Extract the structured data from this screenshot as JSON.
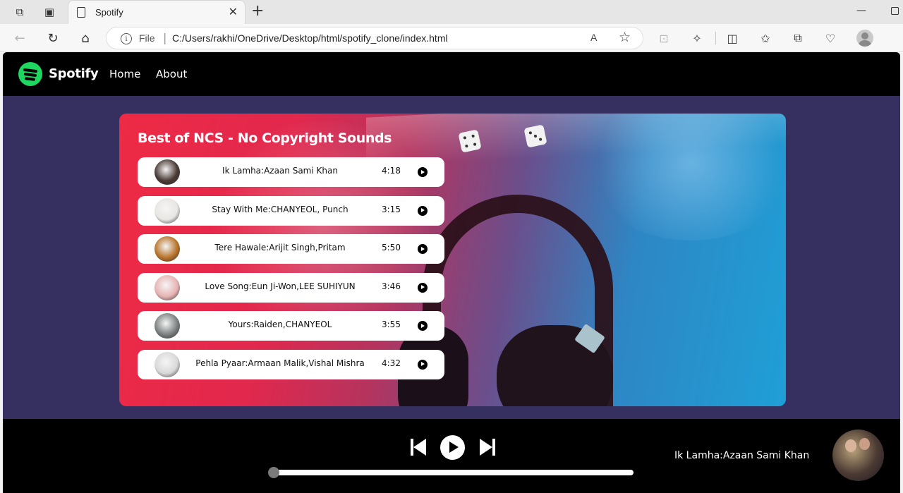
{
  "browser": {
    "tab_title": "Spotify",
    "tab_close": "✕",
    "new_tab": "+",
    "address_scheme": "File",
    "address_separator": "|",
    "address_path": "C:/Users/rakhi/OneDrive/Desktop/html/spotify_clone/index.html",
    "read_aloud": "A",
    "window_min": "—"
  },
  "app": {
    "brand": "Spotify",
    "nav": [
      "Home",
      "About"
    ],
    "colors": {
      "brand_green": "#1ed760",
      "page_bg": "#35305f",
      "bar_bg": "#000000"
    }
  },
  "playlist": {
    "title": "Best of NCS - No Copyright Sounds",
    "songs": [
      {
        "name": "Ik Lamha:Azaan Sami Khan",
        "duration": "4:18",
        "cover": "#4a3a35"
      },
      {
        "name": "Stay With Me:CHANYEOL, Punch",
        "duration": "3:15",
        "cover": "#e9e6e3"
      },
      {
        "name": "Tere Hawale:Arijit Singh,Pritam",
        "duration": "5:50",
        "cover": "#b8742a"
      },
      {
        "name": "Love Song:Eun Ji-Won,LEE SUHIYUN",
        "duration": "3:46",
        "cover": "#e7b4b4"
      },
      {
        "name": "Yours:Raiden,CHANYEOL",
        "duration": "3:55",
        "cover": "#7c8080"
      },
      {
        "name": "Pehla Pyaar:Armaan Malik,Vishal Mishra",
        "duration": "4:32",
        "cover": "#d9d9d9"
      }
    ]
  },
  "player": {
    "now_playing": "Ik Lamha:Azaan Sami Khan",
    "progress": 0.0
  }
}
